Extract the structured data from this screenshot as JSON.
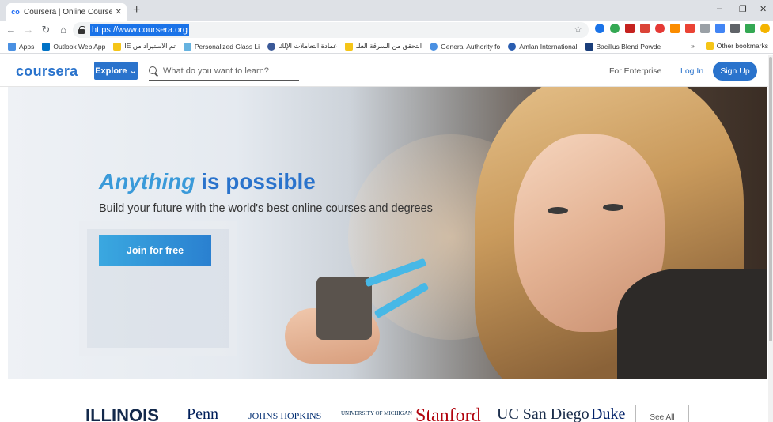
{
  "browser": {
    "tab_title": "Coursera | Online Courses & Cre",
    "favicon": "co",
    "new_tab": "+",
    "url": "https://www.coursera.org",
    "window_controls": [
      "–",
      "❐",
      "✕"
    ],
    "bookmarks": [
      {
        "label": "Apps",
        "color": "#4a90e2"
      },
      {
        "label": "Outlook Web App",
        "color": "#0072c6"
      },
      {
        "label": "IE تم الاستيراد من",
        "color": "#f5c518"
      },
      {
        "label": "Personalized Glass Li",
        "color": "#66b3e0"
      },
      {
        "label": "عمادة التعاملات الإلك",
        "color": "#3b5998"
      },
      {
        "label": "التحقق من السرقة العلـ",
        "color": "#f5c518"
      },
      {
        "label": "General Authority fo",
        "color": "#4a90e2"
      },
      {
        "label": "Amlan International",
        "color": "#2a5db0"
      },
      {
        "label": "Bacillus Blend Powde",
        "color": "#1a3e7a"
      }
    ],
    "overflow_chevron": "»",
    "other_bookmarks": "Other bookmarks",
    "extension_colors": [
      "#1a73e8",
      "#34a853",
      "#db4437",
      "#c5221f",
      "#e53935",
      "#fb8c00",
      "#ea4335",
      "#9aa0a6",
      "#4285f4",
      "#5f6368",
      "#34a853",
      "#f4b400"
    ]
  },
  "header": {
    "logo": "coursera",
    "explore_label": "Explore ⌄",
    "search_placeholder": "What do you want to learn?",
    "enterprise_label": "For Enterprise",
    "login_label": "Log In",
    "signup_label": "Sign Up"
  },
  "hero": {
    "title_emphasis": "Anything",
    "title_rest": " is possible",
    "subtitle": "Build your future with the world's best online courses and degrees",
    "cta_label": "Join for free"
  },
  "partners": {
    "logos": [
      "ILLINOIS",
      "Penn",
      "JOHNS HOPKINS",
      "UNIVERSITY OF MICHIGAN",
      "Stanford",
      "UC San Diego",
      "Duke"
    ],
    "see_all_label": "See All"
  }
}
